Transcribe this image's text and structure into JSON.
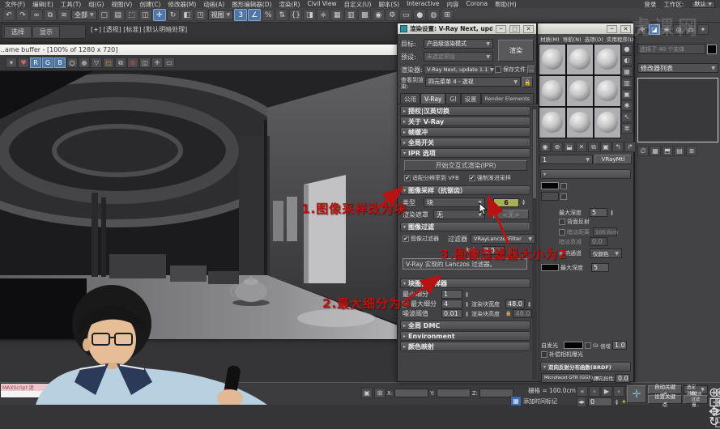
{
  "menubar": {
    "items": [
      {
        "name": "menu-file",
        "label": "文件(F)"
      },
      {
        "name": "menu-edit",
        "label": "编辑(E)"
      },
      {
        "name": "menu-tools",
        "label": "工具(T)"
      },
      {
        "name": "menu-group",
        "label": "组(G)"
      },
      {
        "name": "menu-views",
        "label": "视图(V)"
      },
      {
        "name": "menu-create",
        "label": "创建(C)"
      },
      {
        "name": "menu-modifiers",
        "label": "修改器(M)"
      },
      {
        "name": "menu-animation",
        "label": "动画(A)"
      },
      {
        "name": "menu-graph-editors",
        "label": "图形编辑器(D)"
      },
      {
        "name": "menu-rendering",
        "label": "渲染(R)"
      },
      {
        "name": "menu-civil-view",
        "label": "Civil View"
      },
      {
        "name": "menu-customize",
        "label": "自定义(U)"
      },
      {
        "name": "menu-scripting",
        "label": "脚本(S)"
      },
      {
        "name": "menu-interactive",
        "label": "Interactive"
      },
      {
        "name": "menu-content",
        "label": "内容"
      },
      {
        "name": "menu-corona",
        "label": "Corona"
      },
      {
        "name": "menu-help",
        "label": "帮助(H)"
      }
    ],
    "login_label": "登录",
    "workspace_label": "工作区:",
    "workspace_value": "默认"
  },
  "toolbar": {
    "icons_a": [
      {
        "name": "undo-icon",
        "glyph": "↶"
      },
      {
        "name": "redo-icon",
        "glyph": "↷"
      },
      {
        "name": "select-and-link-icon",
        "glyph": "∞"
      },
      {
        "name": "unlink-selection-icon",
        "glyph": "⧉"
      },
      {
        "name": "bind-to-space-warp-icon",
        "glyph": "≋"
      }
    ],
    "filter_value": "全部",
    "icons_b": [
      {
        "name": "select-object-icon",
        "glyph": "▢"
      },
      {
        "name": "select-by-name-icon",
        "glyph": "▤"
      },
      {
        "name": "rectangular-selection-region-icon",
        "glyph": "⬚"
      },
      {
        "name": "window-crossing-icon",
        "glyph": "◫"
      },
      {
        "name": "select-and-move-icon",
        "glyph": "✛",
        "cls": "hl"
      },
      {
        "name": "select-and-rotate-icon",
        "glyph": "↻"
      },
      {
        "name": "select-and-scale-icon",
        "glyph": "◧"
      },
      {
        "name": "pivot-center-icon",
        "glyph": "◳"
      }
    ],
    "view_value": "视图",
    "icons_c": [
      {
        "name": "snaps-toggle-icon",
        "glyph": "3",
        "cls": "hl"
      },
      {
        "name": "angle-snap-icon",
        "glyph": "∠",
        "cls": "hl"
      },
      {
        "name": "percent-snap-icon",
        "glyph": "%"
      },
      {
        "name": "spinner-snap-icon",
        "glyph": "⇅"
      },
      {
        "name": "named-selection-sets-icon",
        "glyph": "{}"
      },
      {
        "name": "mirror-icon",
        "glyph": "◨"
      },
      {
        "name": "align-icon",
        "glyph": "≑"
      },
      {
        "name": "scene-explorer-icon",
        "glyph": "▦"
      },
      {
        "name": "layer-explorer-icon",
        "glyph": "▥"
      },
      {
        "name": "graph-editors-icon",
        "glyph": "▩"
      },
      {
        "name": "material-editor-icon",
        "glyph": "◉"
      },
      {
        "name": "render-setup-icon",
        "glyph": "⚙"
      },
      {
        "name": "rendered-frame-window-icon",
        "glyph": "▭"
      },
      {
        "name": "render-production-icon",
        "glyph": "●"
      },
      {
        "name": "render-iterative-icon",
        "glyph": "◍"
      },
      {
        "name": "open-in-viewport-icon",
        "glyph": "⊞"
      }
    ]
  },
  "explorer": {
    "tabs": [
      {
        "name": "explorer-tab-select",
        "label": "选择"
      },
      {
        "name": "explorer-tab-display",
        "label": "显示"
      }
    ]
  },
  "viewport": {
    "label": "[+] [透视] [标准] [默认明暗处理]"
  },
  "vfb": {
    "title": "…ame buffer - [100% of 1280 x 720]",
    "icons": [
      {
        "name": "vfb-menu-caret-icon",
        "glyph": "▾"
      },
      {
        "name": "vfb-favorites-icon",
        "glyph": "♥",
        "color": "#c86a6a"
      },
      {
        "name": "vfb-red-channel-icon",
        "glyph": "R",
        "cls": "hlb"
      },
      {
        "name": "vfb-green-channel-icon",
        "glyph": "G",
        "cls": "hlb"
      },
      {
        "name": "vfb-blue-channel-icon",
        "glyph": "B",
        "cls": "hlb"
      },
      {
        "name": "vfb-white-level-icon",
        "glyph": "○",
        "color": "#ffffff"
      },
      {
        "name": "vfb-gray-level-icon",
        "glyph": "●",
        "color": "#9a9a9a"
      },
      {
        "name": "vfb-save-image-icon",
        "glyph": "▽"
      },
      {
        "name": "vfb-load-image-icon",
        "glyph": "◰",
        "color": "#d79a3c"
      },
      {
        "name": "vfb-copy-image-icon",
        "glyph": "⧉"
      },
      {
        "name": "vfb-clear-image-icon",
        "glyph": "⊗",
        "color": "#cc4444"
      },
      {
        "name": "vfb-compare-images-icon",
        "glyph": "◫"
      },
      {
        "name": "vfb-track-mouse-icon",
        "glyph": "✛"
      },
      {
        "name": "vfb-region-render-icon",
        "glyph": "▭"
      }
    ]
  },
  "render_dialog": {
    "title": "渲染设置: V-Ray Next, update…",
    "btn_min": "─",
    "btn_max": "□",
    "btn_close": "✕",
    "target_label": "目标:",
    "target_value": "产品级渲染模式",
    "render_button": "渲染",
    "preset_label": "预设:",
    "preset_value": "未选定预设",
    "renderer_label": "渲染器:",
    "renderer_value": "V-Ray Next, update 1.1",
    "save_file_label": "保存文件",
    "browse_label": "…",
    "view_label": "查看到渲染:",
    "view_value": "四元菜单 4 - 透视",
    "lock_icon": "🔒",
    "tabs": [
      {
        "name": "tab-common",
        "label": "公用"
      },
      {
        "name": "tab-vray",
        "label": "V-Ray",
        "cls": "act"
      },
      {
        "name": "tab-gi",
        "label": "GI"
      },
      {
        "name": "tab-settings",
        "label": "设置"
      },
      {
        "name": "tab-render-elements",
        "label": "Render Elements"
      }
    ],
    "ro_auth": "授权|汉英切换",
    "ro_about": "关于 V-Ray",
    "ro_framebuffer": "帧缓冲",
    "ro_global": "全局开关",
    "ro_ipr": "IPR 选项",
    "ipr_button": "开始交互式渲染(IPR)",
    "ipr_chk1": "适配分辨率到 VFB",
    "ipr_chk2": "强制渐进采样",
    "ro_sampler": "图像采样（抗锯齿）",
    "type_label": "类型",
    "type_value": "块",
    "shading_value": "6",
    "mask_label": "渲染遮罩",
    "mask_value": "无",
    "mask_none_button": "<无>",
    "ro_filter": "图像过滤",
    "filter_chk_label": "图像过滤器",
    "filter_label": "过滤器",
    "filter_value": "VRayLanczosFilter",
    "size_label": "大小",
    "size_value": "2.0",
    "filter_desc": "V-Ray 实现的 Lanczos 过滤器。",
    "ro_bucket": "块图像采样器",
    "min_subdiv_label": "最小细分",
    "min_subdiv_value": "1",
    "max_subdiv_label": "最大细分",
    "max_subdiv_value": "4",
    "bucket_w_label": "渲染块宽度",
    "bucket_w_value": "48.0",
    "noise_label": "噪波阈值",
    "noise_value": "0.01",
    "bucket_h_label": "渲染块高度",
    "bucket_h_value": "48.0",
    "ro_dmc": "全局 DMC",
    "ro_env": "Environment",
    "ro_colormap": "颜色映射",
    "check_glyph": "✔"
  },
  "material_editor": {
    "btn_min": "─",
    "btn_close": "✕",
    "menus": [
      {
        "name": "mat-menu-material",
        "label": "材质(M)"
      },
      {
        "name": "mat-menu-navigation",
        "label": "导航(N)"
      },
      {
        "name": "mat-menu-options",
        "label": "选项(O)"
      },
      {
        "name": "mat-menu-utilities",
        "label": "实用程序(U)"
      }
    ],
    "slots": [
      {
        "name": "material-sample-slot"
      },
      {
        "name": "material-sample-slot"
      },
      {
        "name": "material-sample-slot"
      },
      {
        "name": "material-sample-slot"
      },
      {
        "name": "material-sample-slot"
      },
      {
        "name": "material-sample-slot"
      },
      {
        "name": "material-sample-slot"
      },
      {
        "name": "material-sample-slot"
      },
      {
        "name": "material-sample-slot"
      }
    ],
    "side_icons": [
      {
        "name": "sample-type-icon",
        "glyph": "●"
      },
      {
        "name": "backlight-icon",
        "glyph": "◐"
      },
      {
        "name": "background-icon",
        "glyph": "▦"
      },
      {
        "name": "sample-uv-tiling-icon",
        "glyph": "▥"
      },
      {
        "name": "video-color-check-icon",
        "glyph": "▣"
      },
      {
        "name": "options-icon",
        "glyph": "✱"
      },
      {
        "name": "select-by-material-icon",
        "glyph": "↖"
      },
      {
        "name": "material-map-navigator-icon",
        "glyph": "≣"
      }
    ],
    "bottom_icons": [
      {
        "name": "get-material-icon",
        "glyph": "◉"
      },
      {
        "name": "put-to-scene-icon",
        "glyph": "⊕"
      },
      {
        "name": "assign-to-selection-icon",
        "glyph": "⬓"
      },
      {
        "name": "reset-map-icon",
        "glyph": "✕"
      },
      {
        "name": "make-copy-icon",
        "glyph": "⧉"
      },
      {
        "name": "show-map-in-viewport-icon",
        "glyph": "▣"
      },
      {
        "name": "go-to-parent-icon",
        "glyph": "↰"
      },
      {
        "name": "go-forward-sibling-icon",
        "glyph": "↱"
      }
    ],
    "name_value": "1",
    "type_button": "VRayMtl",
    "params": {
      "max_depth_label": "最大深度",
      "max_depth_value": "5",
      "back_reflect_label": "背面反射",
      "dim_dist_label": "暗淡距离",
      "dim_dist_value": "100.0cm",
      "dim_fall_label": "暗淡衰减",
      "dim_fall_value": "0.0",
      "affect_channels_label": "影响通道",
      "affect_channels_value": "仅颜色",
      "max_depth2_label": "最大深度",
      "max_depth2_value": "5",
      "selfillum_label": "自发光",
      "gi_label": "GI",
      "mult_label": "倍增",
      "mult_value": "1.0",
      "comp_exposure_label": "补偿相机曝光",
      "brdf_header": "双向反射分布函数(BRDF)",
      "brdf_value": "Microfacet GTR (GGX)",
      "aniso_label": "各向异性",
      "aniso_value": "0.0"
    }
  },
  "command_panel": {
    "tabs": [
      {
        "name": "cp-tab-create-icon",
        "glyph": "✛"
      },
      {
        "name": "cp-tab-modify-icon",
        "glyph": "◪",
        "cls": "hlb"
      },
      {
        "name": "cp-tab-hierarchy-icon",
        "glyph": "≡"
      },
      {
        "name": "cp-tab-motion-icon",
        "glyph": "◎"
      },
      {
        "name": "cp-tab-display-icon",
        "glyph": "▭"
      },
      {
        "name": "cp-tab-utilities-icon",
        "glyph": "✶"
      }
    ],
    "name_value": "选择了 40 个实体",
    "modifier_list_label": "修改器列表",
    "stack_icons": [
      {
        "name": "pin-stack-icon",
        "glyph": "∅"
      },
      {
        "name": "show-end-result-icon",
        "glyph": "▦"
      },
      {
        "name": "make-unique-icon",
        "glyph": "⬒"
      },
      {
        "name": "remove-modifier-icon",
        "glyph": "▤"
      },
      {
        "name": "configure-modifier-sets-icon",
        "glyph": "≣"
      }
    ]
  },
  "status_bar": {
    "listener_text": "MAXScript 迷",
    "lock_glyph": "▣",
    "grid_snap_glyph": "⊞",
    "coord_x_label": "X:",
    "coord_y_label": "Y:",
    "coord_z_label": "Z:",
    "grid_label": "栅格 = 100.0cm",
    "time_tag_label": "添加时间标记",
    "transport": [
      {
        "name": "go-to-start-icon",
        "glyph": "«"
      },
      {
        "name": "previous-key-icon",
        "glyph": "‹"
      },
      {
        "name": "play-icon",
        "glyph": "▶"
      },
      {
        "name": "next-key-icon",
        "glyph": "›"
      },
      {
        "name": "go-to-end-icon",
        "glyph": "»"
      }
    ],
    "frame_value": "0",
    "key_mode_glyph": "✦",
    "bigplus_glyph": "✛",
    "autokey_label": "自动关键点",
    "setkey_label": "设置关键点",
    "selection_set_label": "选定对象",
    "key_filters_label": "关键点过滤器...",
    "nav_icons": [
      {
        "name": "zoom-icon",
        "glyph": "⊕"
      },
      {
        "name": "zoom-all-icon",
        "glyph": "⊛"
      },
      {
        "name": "zoom-extents-icon",
        "glyph": "⊡"
      },
      {
        "name": "zoom-region-icon",
        "glyph": "⊞"
      },
      {
        "name": "pan-icon",
        "glyph": "✥"
      },
      {
        "name": "walk-through-icon",
        "glyph": "⊳"
      },
      {
        "name": "orbit-icon",
        "glyph": "↻"
      },
      {
        "name": "maximize-viewport-icon",
        "glyph": "◱"
      }
    ]
  },
  "annotations": {
    "a1": "1.图像采样改为块",
    "a2": "2.最大细分为4",
    "a3": "3.图像过滤器大小为2"
  },
  "watermark": {
    "text": "虎课网"
  }
}
